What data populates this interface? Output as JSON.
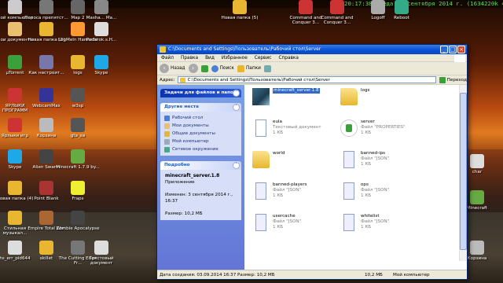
{
  "clock": {
    "text": "20:17:38  среда 03 сентября 2014 г. (1634220k 48%)"
  },
  "desktop_icons": [
    {
      "label": "Мой компьютер",
      "color": "#ccc"
    },
    {
      "label": "Полоса препятст...",
      "color": "#777"
    },
    {
      "label": "Мap 2",
      "color": "#666"
    },
    {
      "label": "Masha... Ma...",
      "color": "#888"
    },
    {
      "label": "Новая папка (5)",
      "color": "#e8b630"
    },
    {
      "label": "Command and Conquer 3...",
      "color": "#c33"
    },
    {
      "label": "Command and Conquer 3...",
      "color": "#c33"
    },
    {
      "label": "Logoff",
      "color": "#aaa"
    },
    {
      "label": "Reboot",
      "color": "#3a8"
    },
    {
      "label": "Мои документы",
      "color": "#e8c070"
    },
    {
      "label": "Новая папка (2)",
      "color": "#e8b630"
    },
    {
      "label": "LogMeIn Hamachi",
      "color": "#f93"
    },
    {
      "label": "Podarok.s.H...",
      "color": "#ddd"
    },
    {
      "label": "µTorrent",
      "color": "#3ba03b"
    },
    {
      "label": "Как настроит...",
      "color": "#77a"
    },
    {
      "label": "logs",
      "color": "#e8b630"
    },
    {
      "label": "Skype",
      "color": "#1ea8e8"
    },
    {
      "label": "ЯРЛЫКИ ПРОГРАММ",
      "color": "#c33"
    },
    {
      "label": "WebcamMax",
      "color": "#339"
    },
    {
      "label": "w3sp",
      "color": "#555"
    },
    {
      "label": "Ярлыки игр",
      "color": "#c33"
    },
    {
      "label": "Корзина",
      "color": "#bbb"
    },
    {
      "label": "gta_sa",
      "color": "#555"
    },
    {
      "label": "Skype",
      "color": "#1ea8e8"
    },
    {
      "label": "Alien Swarm",
      "color": "#444"
    },
    {
      "label": "Minecraft 1.7.9 by...",
      "color": "#6a4"
    },
    {
      "label": "Новая папка (4)",
      "color": "#e8b630"
    },
    {
      "label": "Point Blank",
      "color": "#a33"
    },
    {
      "label": "Fraps",
      "color": "#ee3"
    },
    {
      "label": "Стильная музыкал...",
      "color": "#e8b630"
    },
    {
      "label": "Empire Total War",
      "color": "#a63"
    },
    {
      "label": "Zombie Apocalypse",
      "color": "#444"
    },
    {
      "label": "hs_err_pid644",
      "color": "#ddd"
    },
    {
      "label": "skillet",
      "color": "#e8b630"
    },
    {
      "label": "The Cutting Edge Fr...",
      "color": "#777"
    },
    {
      "label": "Текстовый документ",
      "color": "#ddd"
    },
    {
      "label": "char",
      "color": "#ddd"
    },
    {
      "label": "Minecraft",
      "color": "#6a4"
    },
    {
      "label": "Корзина",
      "color": "#bbb"
    }
  ],
  "window": {
    "title": "C:\\Documents and Settings\\Пользователь\\Рабочий стол\\Server",
    "menu": [
      "Файл",
      "Правка",
      "Вид",
      "Избранное",
      "Сервис",
      "Справка"
    ],
    "toolbar": {
      "back": "Назад",
      "search": "Поиск",
      "folders": "Папки"
    },
    "address_label": "Адрес:",
    "address_value": "C:\\Documents and Settings\\Пользователь\\Рабочий стол\\Server",
    "go_label": "Переход",
    "tasks_header": "Задачи для файлов и папок",
    "places_header": "Другие места",
    "places": [
      {
        "label": "Рабочий стол",
        "color": "#4a7ed8"
      },
      {
        "label": "Мои документы",
        "color": "#e8c070"
      },
      {
        "label": "Общие документы",
        "color": "#e8b630"
      },
      {
        "label": "Мой компьютер",
        "color": "#9ab"
      },
      {
        "label": "Сетевое окружение",
        "color": "#4a8"
      }
    ],
    "details_header": "Подробно",
    "details": {
      "name": "minecraft_server.1.8",
      "type": "Приложение",
      "modified": "Изменен: 3 сентября 2014 г., 16:37",
      "size": "Размер: 10,2 МБ"
    },
    "files": [
      {
        "name": "minecraft_server.1.8",
        "line2": "",
        "line3": "",
        "icon": "mc"
      },
      {
        "name": "logs",
        "line2": "",
        "line3": "",
        "icon": "folder"
      },
      {
        "name": "eula",
        "line2": "Текстовый документ",
        "line3": "1 КБ",
        "icon": "doc"
      },
      {
        "name": "server",
        "line2": "Файл \"PROPERTIES\"",
        "line3": "1 КБ",
        "icon": "ut"
      },
      {
        "name": "world",
        "line2": "",
        "line3": "",
        "icon": "folder"
      },
      {
        "name": "banned-ips",
        "line2": "Файл \"JSON\"",
        "line3": "1 КБ",
        "icon": "doc2"
      },
      {
        "name": "banned-players",
        "line2": "Файл \"JSON\"",
        "line3": "1 КБ",
        "icon": "doc2"
      },
      {
        "name": "ops",
        "line2": "Файл \"JSON\"",
        "line3": "1 КБ",
        "icon": "doc2"
      },
      {
        "name": "usercache",
        "line2": "Файл \"JSON\"",
        "line3": "1 КБ",
        "icon": "doc2"
      },
      {
        "name": "whitelist",
        "line2": "Файл \"JSON\"",
        "line3": "1 КБ",
        "icon": "doc2"
      }
    ],
    "status": {
      "left": "Дата создания: 03.09.2014 16:37 Размер: 10,2 МБ",
      "size": "10,2 МБ",
      "location": "Мой компьютер"
    }
  }
}
